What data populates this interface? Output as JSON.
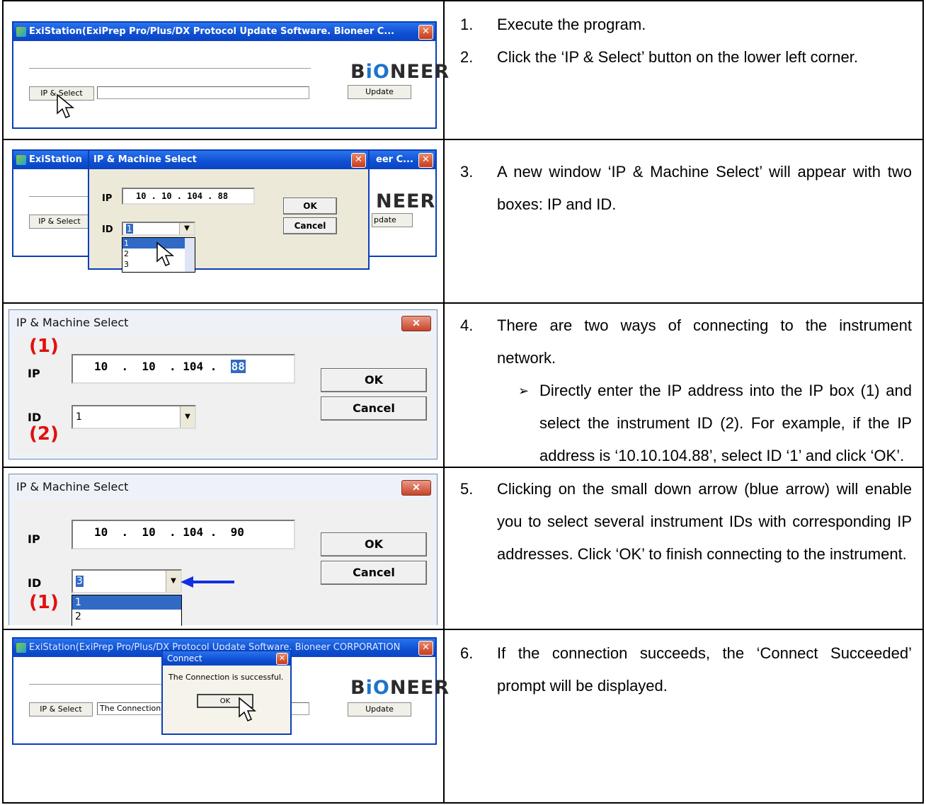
{
  "steps": [
    {
      "number": "1.",
      "text": "Execute the program."
    },
    {
      "number": "2.",
      "text": "Click the ‘IP & Select’ button on the lower left corner."
    },
    {
      "number": "3.",
      "text": "A new window ‘IP & Machine Select’ will appear with two boxes: IP and ID."
    },
    {
      "number": "4.",
      "text": "There are two ways of connecting to the instrument network.",
      "bullet": "➢",
      "sub_text": "Directly enter the IP address into the IP box (1) and select the instrument ID (2). For example, if the IP address is ‘10.10.104.88’, select ID ‘1’ and click ‘OK’."
    },
    {
      "number": "5.",
      "text": "Clicking on the small down arrow (blue arrow) will enable you to select several instrument IDs with corresponding IP addresses. Click ‘OK’ to finish connecting to the instrument."
    },
    {
      "number": "6.",
      "text": "If the connection succeeds, the ‘Connect Succeeded’ prompt will be displayed."
    }
  ],
  "shot1": {
    "title": "ExiStation(ExiPrep Pro/Plus/DX Protocol Update Software. Bioneer C...",
    "logo_prefix": "B",
    "logo_accent": "iO",
    "logo_suffix": "NEER",
    "ip_select_label": "IP & Select",
    "update_label": "Update"
  },
  "shot2": {
    "bg_title": "ExiStation",
    "bg_title_right": "eer C...",
    "dialog_title": "IP & Machine Select",
    "ip_label": "IP",
    "ip_value": "10 . 10 . 104 . 88",
    "id_label": "ID",
    "id_value": "1",
    "ok_label": "OK",
    "cancel_label": "Cancel",
    "logo_partial": "NEER",
    "update_partial": "pdate",
    "ip_select_label": "IP & Select",
    "options": [
      "1",
      "2",
      "3"
    ]
  },
  "shot3": {
    "title": "IP & Machine Select",
    "marker_ip": "(1)",
    "marker_id": "(2)",
    "ip_label": "IP",
    "ip_value_main": "10  .  10  . 104 .  ",
    "ip_value_sel": "88",
    "id_label": "ID",
    "id_value": "1",
    "ok_label": "OK",
    "cancel_label": "Cancel"
  },
  "shot4": {
    "title": "IP & Machine Select",
    "marker": "(1)",
    "ip_label": "IP",
    "ip_value": "10  .  10  . 104 .  90",
    "id_label": "ID",
    "id_value": "3",
    "ok_label": "OK",
    "cancel_label": "Cancel",
    "options": [
      "1",
      "2"
    ]
  },
  "shot5": {
    "title": "ExiStation(ExiPrep Pro/Plus/DX Protocol Update Software. Bioneer CORPORATION",
    "connect_title": "Connect",
    "connect_message": "The Connection is successful.",
    "ok_label": "OK",
    "ip_select_label": "IP & Select",
    "status_text": "The Connection",
    "update_label": "Update",
    "logo_prefix": "B",
    "logo_accent": "iO",
    "logo_suffix": "NEER"
  },
  "colors": {
    "xp_title_blue": "#0e4fd1",
    "marker_red": "#e01010",
    "selection_blue": "#316ac5",
    "arrow_blue": "#1030e0"
  }
}
